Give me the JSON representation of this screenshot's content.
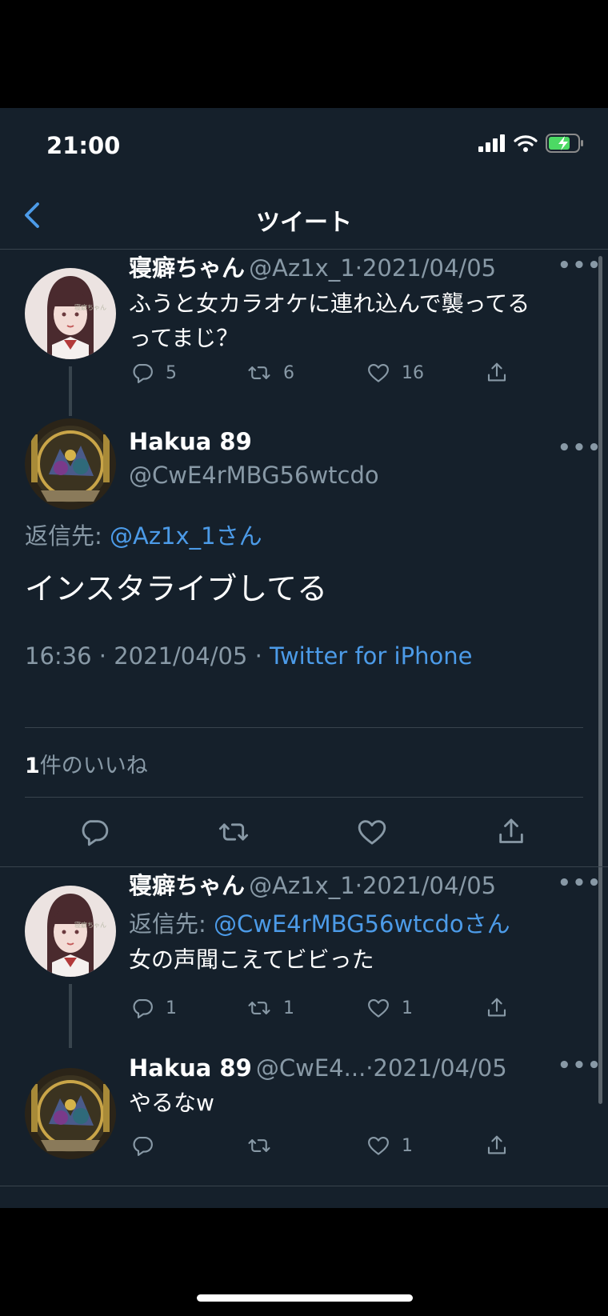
{
  "status_bar": {
    "time": "21:00"
  },
  "nav": {
    "title": "ツイート"
  },
  "tweet1": {
    "name": "寝癖ちゃん",
    "handle": "@Az1x_1",
    "sep": "·",
    "date": "2021/04/05",
    "text_line1": "ふうと女カラオケに連れ込んで襲ってる",
    "text_line2": "ってまじ？",
    "replies": "5",
    "retweets": "6",
    "likes": "16"
  },
  "main_tweet": {
    "name": "Hakua 89",
    "handle": "@CwE4rMBG56wtcdo",
    "reply_prefix": "返信先: ",
    "reply_to": "@Az1x_1さん",
    "text": "インスタライブしてる",
    "time_date": "16:36 · 2021/04/05 · ",
    "source": "Twitter for iPhone",
    "likes_count": "1",
    "likes_label": "件のいいね"
  },
  "tweet3": {
    "name": "寝癖ちゃん",
    "handle": "@Az1x_1",
    "sep": "·",
    "date": "2021/04/05",
    "reply_prefix": "返信先: ",
    "reply_to": "@CwE4rMBG56wtcdoさん",
    "text": "女の声聞こえてビビった",
    "replies": "1",
    "retweets": "1",
    "likes": "1"
  },
  "tweet4": {
    "name": "Hakua 89",
    "handle": "@CwE4...",
    "sep": "·",
    "date": "2021/04/05",
    "text": "やるなw",
    "likes": "1"
  },
  "icons": [
    "back-chevron-icon",
    "signal-icon",
    "wifi-icon",
    "battery-icon",
    "more-icon",
    "reply-icon",
    "retweet-icon",
    "like-icon",
    "share-icon"
  ],
  "colors": {
    "background": "#15202b",
    "accent": "#4c9be8",
    "secondary": "#8899a6",
    "battery": "#4cd964"
  }
}
